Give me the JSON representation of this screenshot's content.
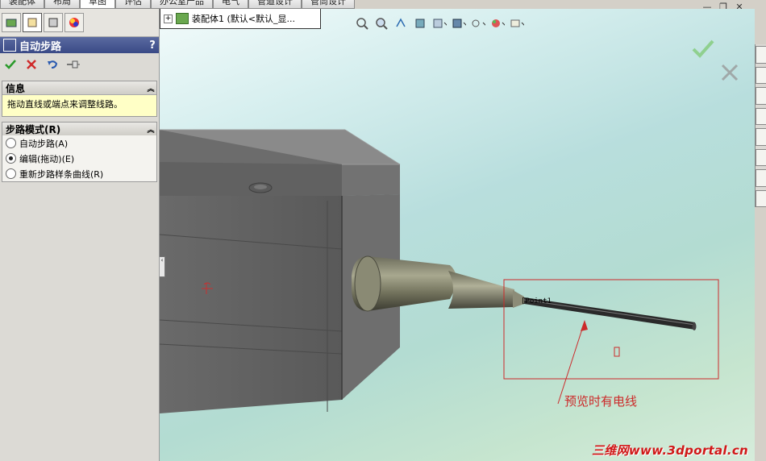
{
  "top_tabs": [
    "装配体",
    "布局",
    "草图",
    "评估",
    "办公室产品",
    "电气",
    "管道设计",
    "管筒设计"
  ],
  "active_tab": 2,
  "property_manager": {
    "title": "自动步路",
    "help": "?"
  },
  "info_group": {
    "title": "信息",
    "message": "拖动直线或端点来调整线路。"
  },
  "route_mode_group": {
    "title": "步路模式(R)",
    "options": [
      {
        "label": "自动步路(A)",
        "selected": false
      },
      {
        "label": "编辑(拖动)(E)",
        "selected": true
      },
      {
        "label": "重新步路样条曲线(R)",
        "selected": false
      }
    ]
  },
  "feature_tree": {
    "expander": "+",
    "label": "装配体1 (默认<默认_显..."
  },
  "viewport": {
    "point_label": "[Point1",
    "annotation_text": "预览时有电线",
    "watermark": "三维网www.3dportal.cn"
  },
  "colors": {
    "annotation": "#cc2a2a",
    "header": "#3a4a86",
    "info_bg": "#ffffc6"
  }
}
